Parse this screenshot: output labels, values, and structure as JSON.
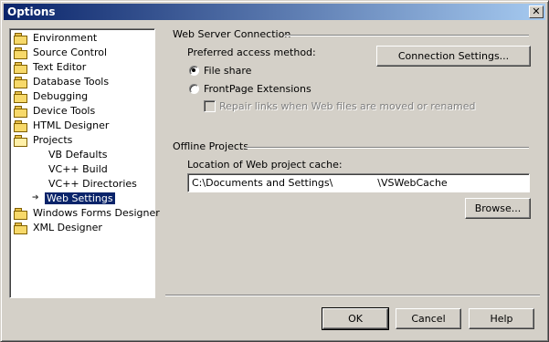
{
  "window": {
    "title": "Options"
  },
  "tree": {
    "items": [
      {
        "label": "Environment",
        "folder": true
      },
      {
        "label": "Source Control",
        "folder": true
      },
      {
        "label": "Text Editor",
        "folder": true
      },
      {
        "label": "Database Tools",
        "folder": true
      },
      {
        "label": "Debugging",
        "folder": true
      },
      {
        "label": "Device Tools",
        "folder": true
      },
      {
        "label": "HTML Designer",
        "folder": true
      },
      {
        "label": "Projects",
        "folder": true,
        "expanded": true
      },
      {
        "label": "VB Defaults",
        "folder": false
      },
      {
        "label": "VC++ Build",
        "folder": false
      },
      {
        "label": "VC++ Directories",
        "folder": false
      },
      {
        "label": "Web Settings",
        "folder": false,
        "selected": true
      },
      {
        "label": "Windows Forms Designer",
        "folder": true
      },
      {
        "label": "XML Designer",
        "folder": true
      }
    ]
  },
  "web_server": {
    "group_title": "Web Server Connection",
    "preferred_label": "Preferred access method:",
    "file_share": {
      "label": "File share",
      "checked": true
    },
    "frontpage": {
      "label": "FrontPage Extensions",
      "checked": false
    },
    "repair_links": {
      "label": "Repair links when Web files are moved or renamed",
      "checked": false,
      "enabled": false
    },
    "connection_settings_label": "Connection Settings..."
  },
  "offline": {
    "group_title": "Offline Projects",
    "location_label": "Location of Web project cache:",
    "location_value": "C:\\Documents and Settings\\              \\VSWebCache",
    "browse_label": "Browse..."
  },
  "buttons": {
    "ok": "OK",
    "cancel": "Cancel",
    "help": "Help"
  },
  "icons": {
    "close": "close-icon",
    "folder": "folder-icon",
    "selected_arrow": "arrow-right-icon"
  }
}
